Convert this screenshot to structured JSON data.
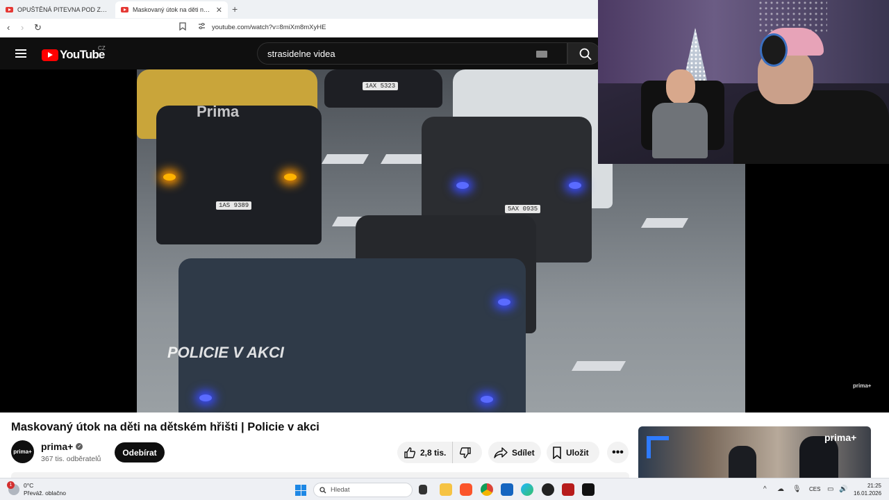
{
  "browser": {
    "tabs": [
      {
        "label": "OPUŠTĚNÁ PITEVNA POD ZEMÍ – M",
        "active": false
      },
      {
        "label": "Maskovaný útok na děti na dět",
        "active": true
      }
    ],
    "url": "youtube.com/watch?v=8miXm8mXyHE"
  },
  "youtube": {
    "logo_text": "YouTube",
    "country_code": "CZ",
    "search_query": "strasidelne videa"
  },
  "video": {
    "watermark_brand": "Prima",
    "watermark_show": "POLICIE V AKCI",
    "watermark_corner": "prima+",
    "plates": [
      "1AS 9389",
      "5AX 0935",
      "1AX 5323"
    ]
  },
  "meta": {
    "title": "Maskovaný útok na děti na dětském hřišti | Policie v akci",
    "channel_name": "prima+",
    "avatar_text": "prima+",
    "subscribers": "367 tis. odběratelů",
    "subscribe_label": "Odebírat",
    "like_count": "2,8 tis.",
    "share_label": "Sdílet",
    "save_label": "Uložit",
    "more_label": "•••"
  },
  "sidebar_thumb": {
    "brand": "prima+"
  },
  "taskbar": {
    "weather_temp": "0°C",
    "weather_desc": "Převáž. oblačno",
    "weather_badge": "1",
    "search_placeholder": "Hledat",
    "language": "CES",
    "time": "21:25",
    "date": "16.01.2026"
  },
  "colors": {
    "youtube_red": "#ff0000",
    "header_bg": "#0f0f0f",
    "pill_bg": "#f2f2f2"
  }
}
